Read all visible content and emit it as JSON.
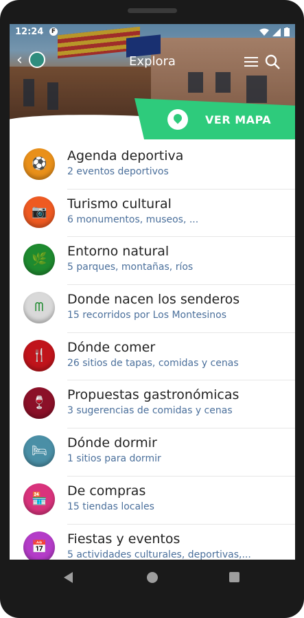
{
  "status": {
    "time": "12:24",
    "app_badge": "F"
  },
  "header": {
    "title": "Explora"
  },
  "map_button": {
    "label": "VER MAPA",
    "color": "#2ecb7c"
  },
  "items": [
    {
      "title": "Agenda deportiva",
      "subtitle": "2 eventos deportivos",
      "icon": "sports-icon",
      "color": "#e9901a",
      "glyph": "⚽"
    },
    {
      "title": "Turismo cultural",
      "subtitle": "6 monumentos, museos, ...",
      "icon": "camera-icon",
      "color": "#ee5a22",
      "glyph": "📷"
    },
    {
      "title": "Entorno natural",
      "subtitle": "5 parques, montañas, ríos",
      "icon": "nature-icon",
      "color": "#1e8a2f",
      "glyph": "🌿"
    },
    {
      "title": "Donde nacen los senderos",
      "subtitle": "15 recorridos por Los Montesinos",
      "icon": "trail-icon",
      "color": "#d9d9d9",
      "glyph": "ᗰ"
    },
    {
      "title": "Dónde comer",
      "subtitle": "26 sitios de tapas, comidas y cenas",
      "icon": "cutlery-icon",
      "color": "#c0141b",
      "glyph": "🍴"
    },
    {
      "title": "Propuestas gastronómicas",
      "subtitle": "3 sugerencias de comidas y cenas",
      "icon": "gastronomy-icon",
      "color": "#8b1028",
      "glyph": "🍷"
    },
    {
      "title": "Dónde dormir",
      "subtitle": "1 sitios para dormir",
      "icon": "bed-icon",
      "color": "#4a8fa6",
      "glyph": "🛏"
    },
    {
      "title": "De compras",
      "subtitle": "15 tiendas locales",
      "icon": "shop-icon",
      "color": "#d9337c",
      "glyph": "🏪"
    },
    {
      "title": "Fiestas y eventos",
      "subtitle": "5 actividades culturales, deportivas,...",
      "icon": "calendar-icon",
      "color": "#b43cc8",
      "glyph": "📅"
    }
  ]
}
